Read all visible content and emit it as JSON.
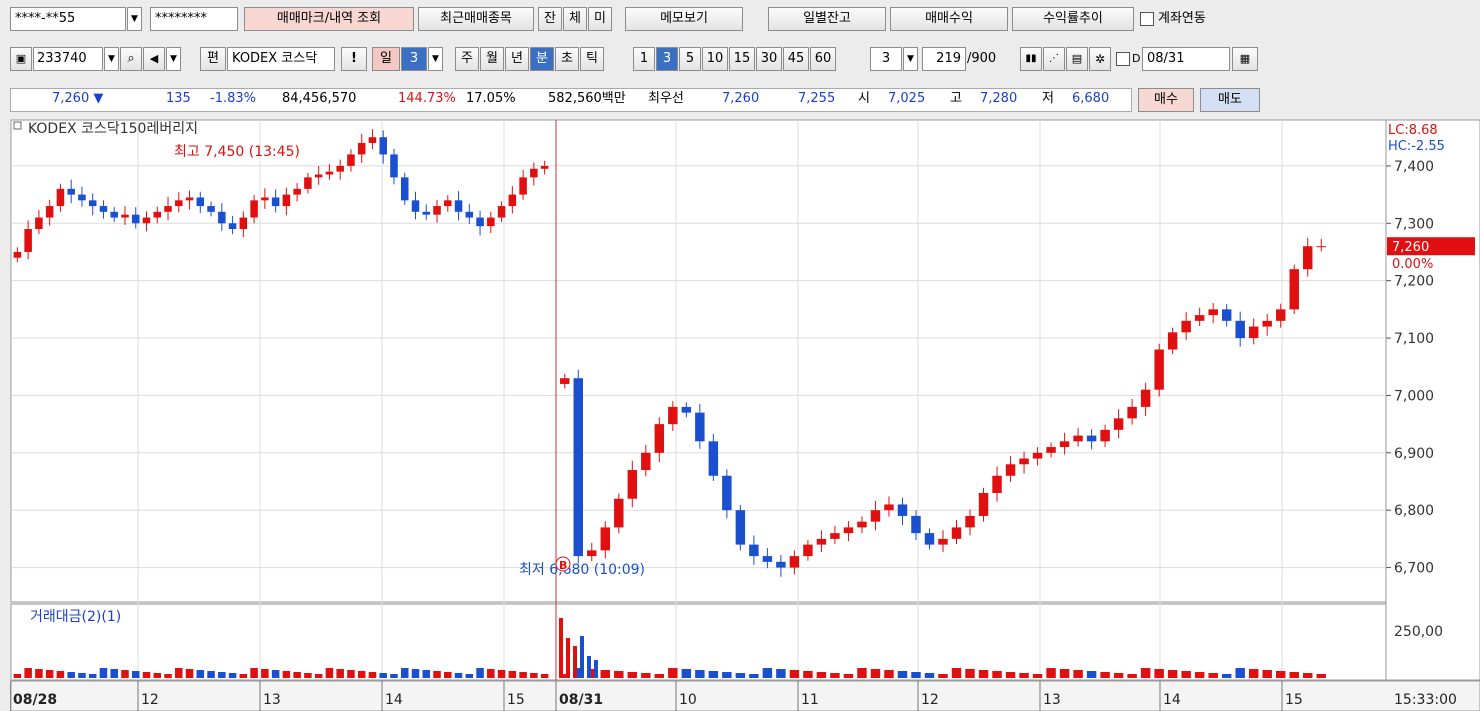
{
  "toolbar1": {
    "account": "****-**55",
    "password": "********",
    "btn_mark": "매매마크/내역 조회",
    "btn_recent": "최근매매종목",
    "btn_jan": "잔",
    "btn_che": "체",
    "btn_mi": "미",
    "btn_memo": "메모보기",
    "btn_daily": "일별잔고",
    "btn_profit": "매매수익",
    "btn_trend": "수익률추이",
    "link_label": "계좌연동"
  },
  "toolbar2": {
    "code": "233740",
    "pen": "편",
    "name": "KODEX 코스닥",
    "alert": "!",
    "period_day": "일",
    "period_n": "3",
    "periods": [
      "주",
      "월",
      "년",
      "분",
      "초",
      "틱"
    ],
    "active_period": "분",
    "intervals": [
      "1",
      "3",
      "5",
      "10",
      "15",
      "30",
      "45",
      "60"
    ],
    "active_interval": "3",
    "count": "3",
    "bars": "219",
    "bars_total": "/900",
    "d_label": "D",
    "date": "08/31"
  },
  "quote": {
    "price": "7,260 ▼",
    "change": "135",
    "change_pct": "-1.83%",
    "volume": "84,456,570",
    "vol_ratio": "144.73%",
    "turnover": "17.05%",
    "amount": "582,560백만",
    "best_label": "최우선",
    "ask": "7,260",
    "bid": "7,255",
    "open_label": "시",
    "open": "7,025",
    "high_label": "고",
    "high": "7,280",
    "low_label": "저",
    "low": "6,680",
    "buy": "매수",
    "sell": "매도"
  },
  "chart_data": {
    "type": "candlestick",
    "title": "KODEX 코스닥150레버리지",
    "lc": "LC:8.68",
    "hc": "HC:-2.55",
    "price_ticks": [
      "7,400",
      "7,300",
      "7,200",
      "7,100",
      "7,000",
      "6,900",
      "6,800",
      "6,700"
    ],
    "ylim": [
      6640,
      7480
    ],
    "current_price": "7,260",
    "current_pct": "0.00%",
    "high_marker": "최고 7,450 (13:45)",
    "low_marker": "최저 6,680 (10:09)",
    "b_marker": "B",
    "volume_title": "거래대금(2)(1)",
    "volume_tick": "250,00",
    "x_labels": [
      "08/28",
      "12",
      "13",
      "14",
      "15",
      "08/31",
      "10",
      "11",
      "12",
      "13",
      "14",
      "15"
    ],
    "time_label": "15:33:00",
    "colors": {
      "up": "#e01010",
      "down": "#1a4fd0",
      "grid": "#dcdcdc"
    },
    "day1_close_path": [
      7250,
      7290,
      7310,
      7330,
      7360,
      7350,
      7340,
      7330,
      7320,
      7310,
      7315,
      7300,
      7310,
      7320,
      7330,
      7340,
      7345,
      7330,
      7320,
      7300,
      7290,
      7310,
      7340,
      7345,
      7330,
      7350,
      7360,
      7380,
      7385,
      7390,
      7400,
      7420,
      7440,
      7450,
      7420,
      7380,
      7340,
      7320,
      7315,
      7330,
      7340,
      7320,
      7310,
      7295,
      7310,
      7330,
      7350,
      7380,
      7395,
      7400
    ],
    "day2_close_path": [
      7030,
      6720,
      6730,
      6770,
      6820,
      6870,
      6900,
      6950,
      6980,
      6970,
      6920,
      6860,
      6800,
      6740,
      6720,
      6710,
      6700,
      6720,
      6740,
      6750,
      6760,
      6770,
      6780,
      6800,
      6810,
      6790,
      6760,
      6740,
      6750,
      6770,
      6790,
      6830,
      6860,
      6880,
      6890,
      6900,
      6910,
      6920,
      6930,
      6920,
      6940,
      6960,
      6980,
      7010,
      7080,
      7110,
      7130,
      7140,
      7150,
      7130,
      7100,
      7120,
      7130,
      7150,
      7220,
      7260,
      7260
    ]
  }
}
